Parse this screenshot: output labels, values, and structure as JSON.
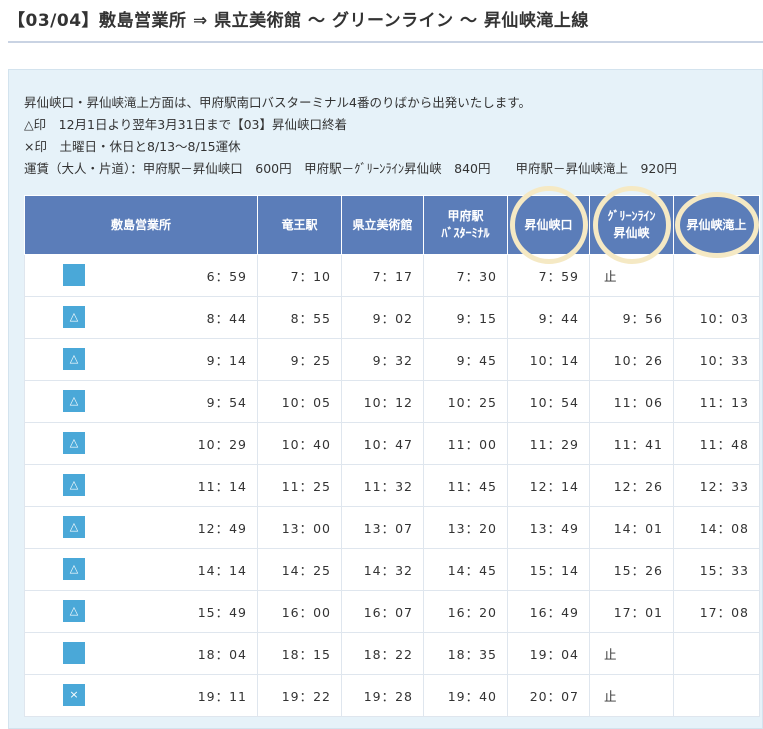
{
  "title": "【03/04】敷島営業所 ⇒ 県立美術館 ～ グリーンライン ～ 昇仙峡滝上線",
  "notes": [
    "昇仙峡口・昇仙峡滝上方面は、甲府駅南口バスターミナル4番のりばから出発いたします。",
    "△印　12月1日より翌年3月31日まで【03】昇仙峡口終着",
    "×印　土曜日・休日と8/13～8/15運休",
    "運賃（大人・片道）：甲府駅－昇仙峡口　600円　甲府駅－ｸﾞﾘｰﾝﾗｲﾝ昇仙峡　840円　　甲府駅－昇仙峡滝上　920円"
  ],
  "headers": [
    "敷島営業所",
    "竜王駅",
    "県立美術館",
    "甲府駅\nﾊﾞｽﾀｰﾐﾅﾙ",
    "昇仙峡口",
    "ｸﾞﾘｰﾝﾗｲﾝ\n昇仙峡",
    "昇仙峡滝上"
  ],
  "rows": [
    {
      "mark": "",
      "times": [
        "6：59",
        "7：10",
        "7：17",
        "7：30",
        "7：59",
        "止",
        ""
      ]
    },
    {
      "mark": "△",
      "times": [
        "8：44",
        "8：55",
        "9：02",
        "9：15",
        "9：44",
        "9：56",
        "10：03"
      ]
    },
    {
      "mark": "△",
      "times": [
        "9：14",
        "9：25",
        "9：32",
        "9：45",
        "10：14",
        "10：26",
        "10：33"
      ]
    },
    {
      "mark": "△",
      "times": [
        "9：54",
        "10：05",
        "10：12",
        "10：25",
        "10：54",
        "11：06",
        "11：13"
      ]
    },
    {
      "mark": "△",
      "times": [
        "10：29",
        "10：40",
        "10：47",
        "11：00",
        "11：29",
        "11：41",
        "11：48"
      ]
    },
    {
      "mark": "△",
      "times": [
        "11：14",
        "11：25",
        "11：32",
        "11：45",
        "12：14",
        "12：26",
        "12：33"
      ]
    },
    {
      "mark": "△",
      "times": [
        "12：49",
        "13：00",
        "13：07",
        "13：20",
        "13：49",
        "14：01",
        "14：08"
      ]
    },
    {
      "mark": "△",
      "times": [
        "14：14",
        "14：25",
        "14：32",
        "14：45",
        "15：14",
        "15：26",
        "15：33"
      ]
    },
    {
      "mark": "△",
      "times": [
        "15：49",
        "16：00",
        "16：07",
        "16：20",
        "16：49",
        "17：01",
        "17：08"
      ]
    },
    {
      "mark": "",
      "times": [
        "18：04",
        "18：15",
        "18：22",
        "18：35",
        "19：04",
        "止",
        ""
      ]
    },
    {
      "mark": "×",
      "times": [
        "19：11",
        "19：22",
        "19：28",
        "19：40",
        "20：07",
        "止",
        ""
      ]
    }
  ],
  "colors": {
    "header_bg": "#5b7db9",
    "mark_bg": "#4aa8d8",
    "panel_bg": "#e6f2f9",
    "highlight_ring": "#f5e9c4"
  }
}
